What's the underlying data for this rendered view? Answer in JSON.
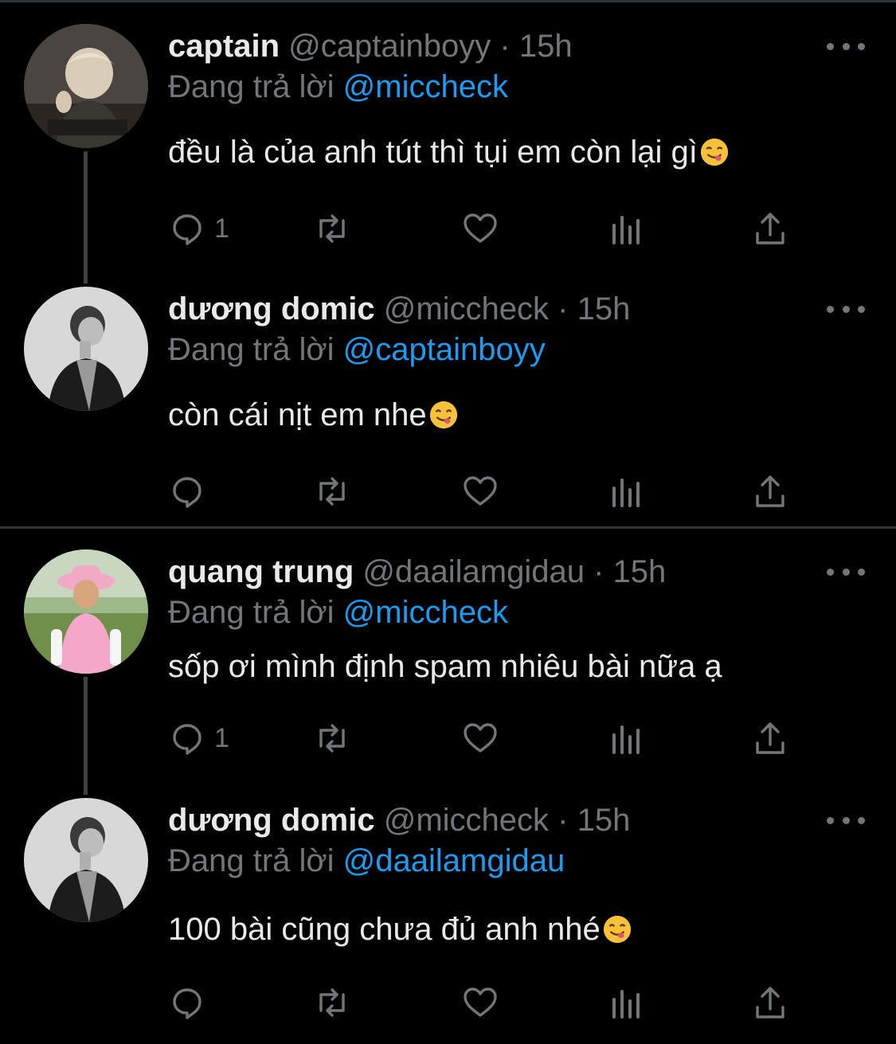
{
  "reply_prefix": "Đang trả lời",
  "tweets": [
    {
      "name": "captain",
      "handle": "@captainboyy",
      "separator": "·",
      "time": "15h",
      "reply_to": "@miccheck",
      "text": "đều là của anh tút thì tụi em còn lại gì",
      "reply_count": "1"
    },
    {
      "name": "dương domic",
      "handle": "@miccheck",
      "separator": "·",
      "time": "15h",
      "reply_to": "@captainboyy",
      "text": "còn cái nịt em nhe",
      "reply_count": ""
    },
    {
      "name": "quang trung",
      "handle": "@daailamgidau",
      "separator": "·",
      "time": "15h",
      "reply_to": "@miccheck",
      "text": "sốp ơi mình định spam nhiêu bài nữa ạ",
      "reply_count": "1"
    },
    {
      "name": "dương domic",
      "handle": "@miccheck",
      "separator": "·",
      "time": "15h",
      "reply_to": "@daailamgidau",
      "text": "100 bài cũng chưa đủ anh nhé",
      "reply_count": ""
    }
  ],
  "icons": {
    "reply": "reply-icon",
    "retweet": "retweet-icon",
    "like": "heart-icon",
    "views": "views-icon",
    "share": "share-icon",
    "more": "more-icon",
    "emoji": "yum-face-emoji"
  },
  "colors": {
    "background": "#000000",
    "text": "#e7e9ea",
    "muted": "#71767b",
    "mention": "#1d9bf0",
    "divider": "#2f3336"
  }
}
